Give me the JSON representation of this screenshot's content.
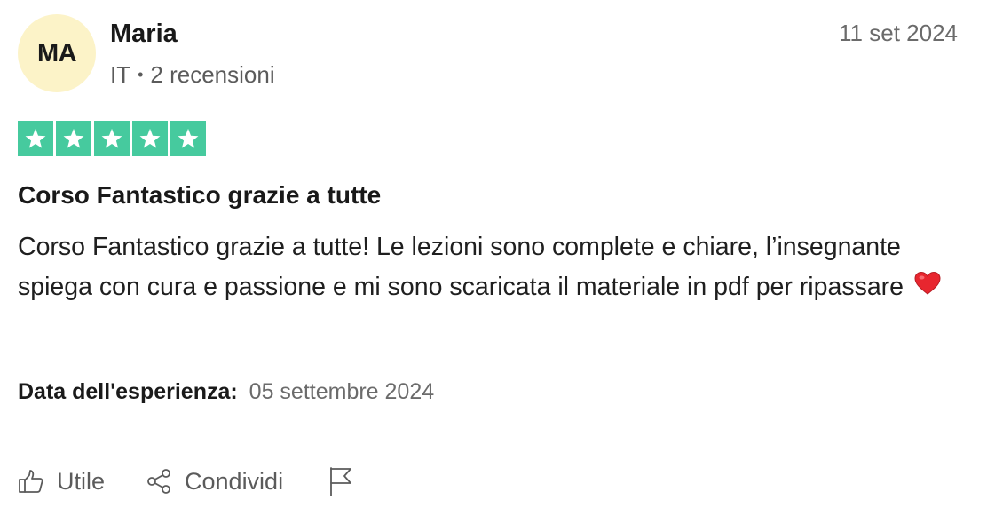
{
  "reviewer": {
    "initials": "MA",
    "name": "Maria",
    "country": "IT",
    "separator": "•",
    "review_count": "2 recensioni",
    "avatar_color": "#fcf3c8"
  },
  "review": {
    "date": "11 set 2024",
    "rating": 5,
    "rating_max": 5,
    "star_color": "#00b67a",
    "title": "Corso Fantastico grazie a tutte",
    "body": "Corso Fantastico grazie a tutte! Le lezioni sono complete e chiare, l’insegnante spiega con cura e passione e mi sono scaricata il materiale in pdf per ripassare",
    "body_emoji": "heart-emoji",
    "experience_label": "Data dell'esperienza:",
    "experience_date": "05 settembre 2024"
  },
  "actions": {
    "useful_label": "Utile",
    "useful_icon": "thumbs-up-icon",
    "share_label": "Condividi",
    "share_icon": "share-icon",
    "report_icon": "flag-icon"
  }
}
